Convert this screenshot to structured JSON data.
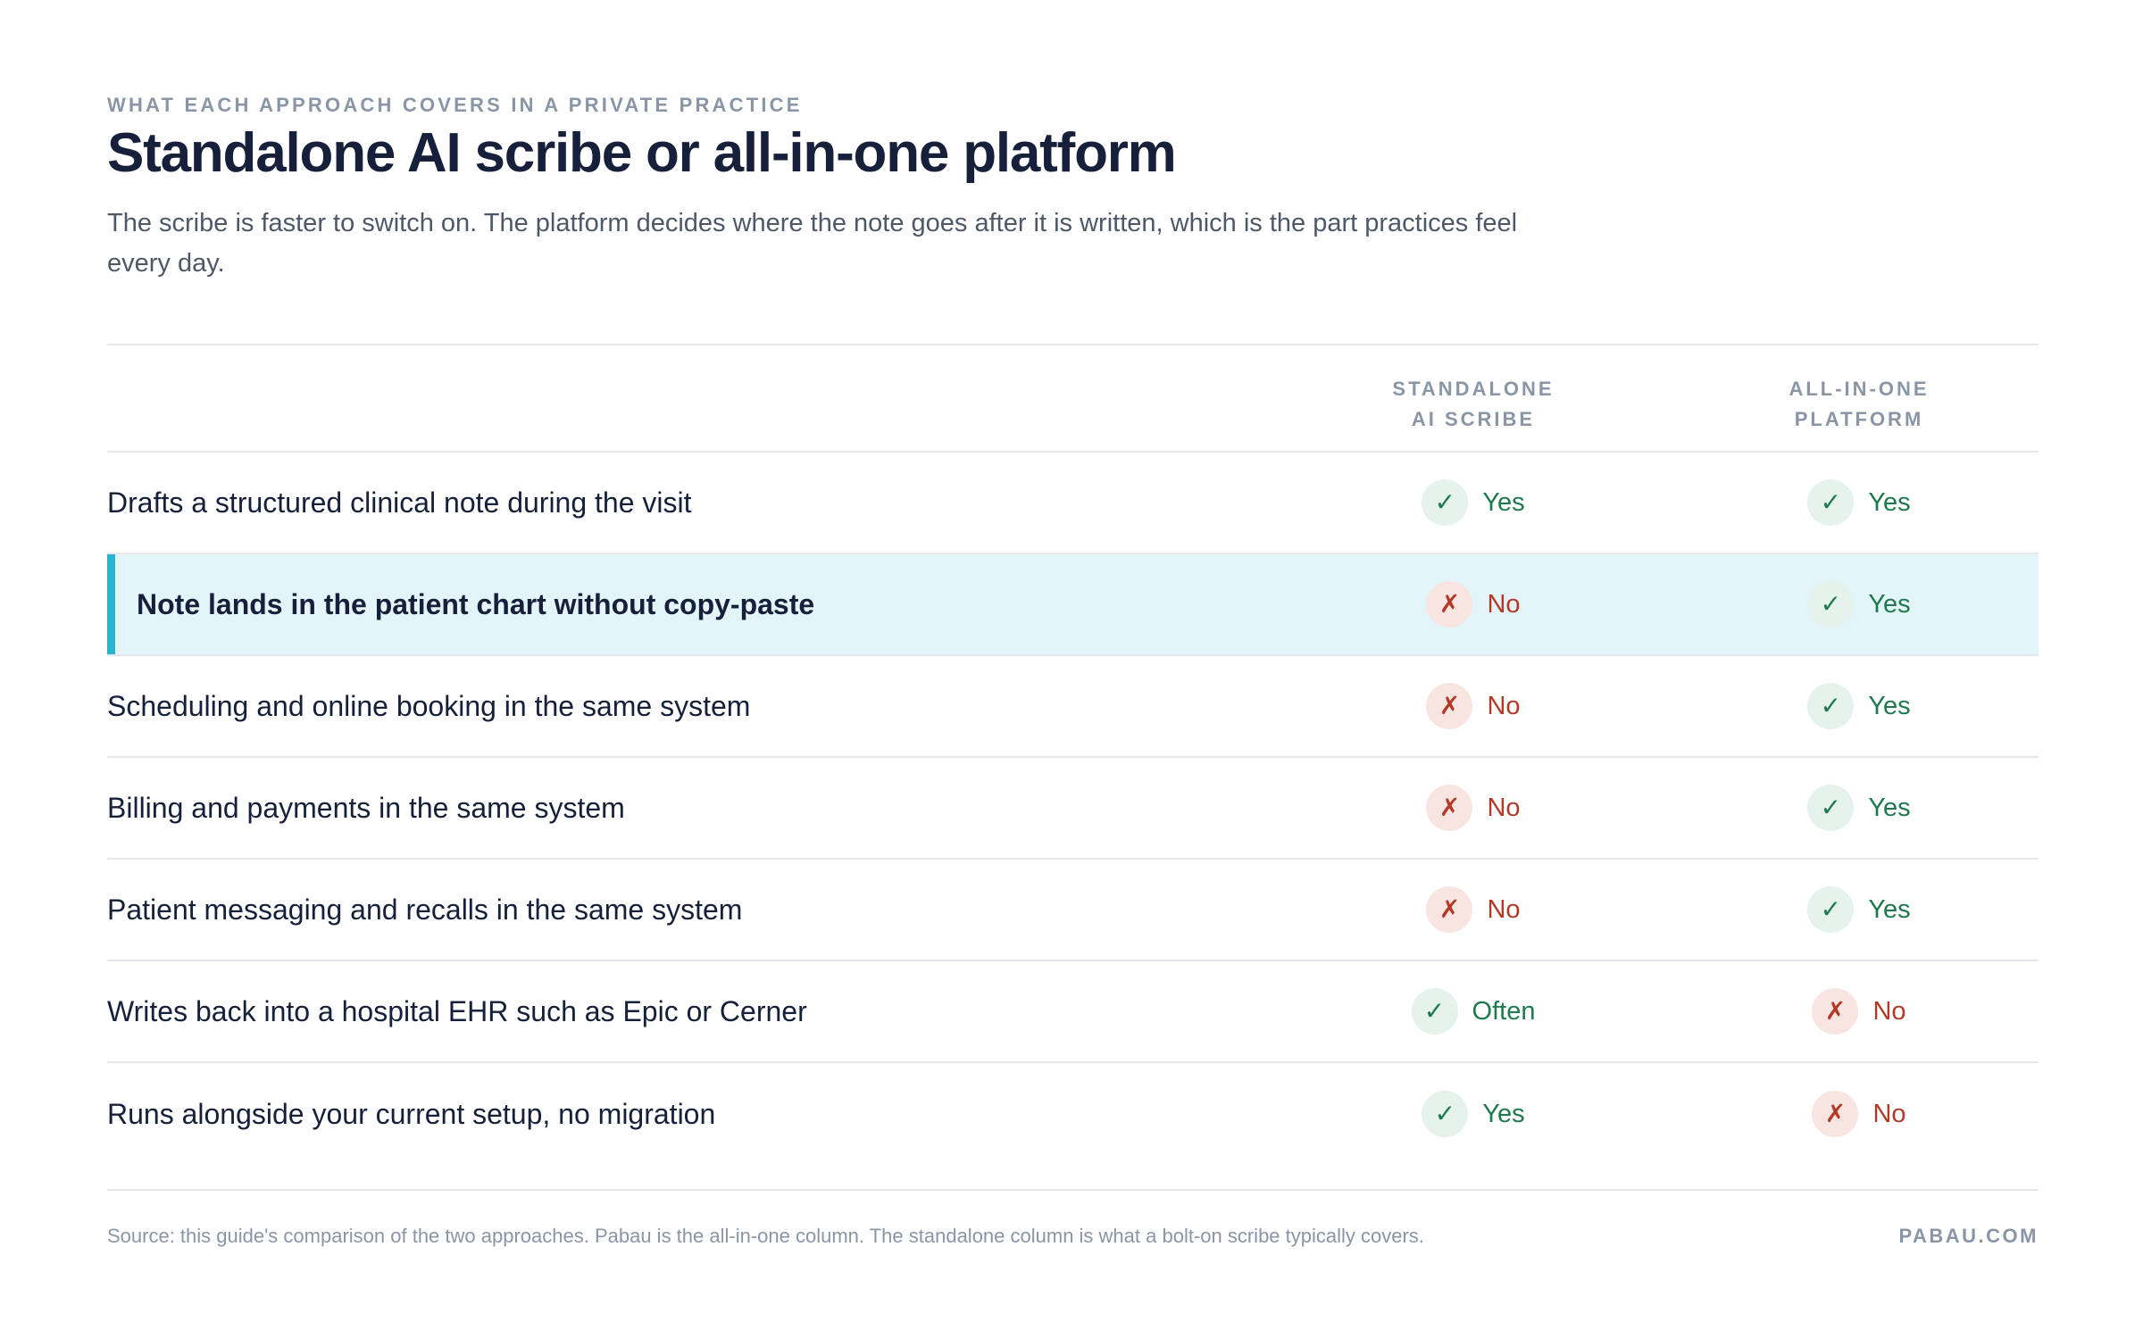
{
  "header": {
    "eyebrow": "WHAT EACH APPROACH COVERS IN A PRIVATE PRACTICE",
    "title": "Standalone AI scribe or all-in-one platform",
    "subtitle": "The scribe is faster to switch on. The platform decides where the note goes after it is written, which is the part practices feel every day."
  },
  "table": {
    "columns": [
      {
        "line1": "STANDALONE",
        "line2": "AI SCRIBE"
      },
      {
        "line1": "ALL-IN-ONE",
        "line2": "PLATFORM"
      }
    ],
    "rows": [
      {
        "label": "Drafts a structured clinical note during the visit",
        "highlight": false,
        "c1": {
          "text": "Yes",
          "status": "yes"
        },
        "c2": {
          "text": "Yes",
          "status": "yes"
        }
      },
      {
        "label": "Note lands in the patient chart without copy-paste",
        "highlight": true,
        "c1": {
          "text": "No",
          "status": "no"
        },
        "c2": {
          "text": "Yes",
          "status": "yes"
        }
      },
      {
        "label": "Scheduling and online booking in the same system",
        "highlight": false,
        "c1": {
          "text": "No",
          "status": "no"
        },
        "c2": {
          "text": "Yes",
          "status": "yes"
        }
      },
      {
        "label": "Billing and payments in the same system",
        "highlight": false,
        "c1": {
          "text": "No",
          "status": "no"
        },
        "c2": {
          "text": "Yes",
          "status": "yes"
        }
      },
      {
        "label": "Patient messaging and recalls in the same system",
        "highlight": false,
        "c1": {
          "text": "No",
          "status": "no"
        },
        "c2": {
          "text": "Yes",
          "status": "yes"
        }
      },
      {
        "label": "Writes back into a hospital EHR such as Epic or Cerner",
        "highlight": false,
        "c1": {
          "text": "Often",
          "status": "yes"
        },
        "c2": {
          "text": "No",
          "status": "no"
        }
      },
      {
        "label": "Runs alongside your current setup, no migration",
        "highlight": false,
        "c1": {
          "text": "Yes",
          "status": "yes"
        },
        "c2": {
          "text": "No",
          "status": "no"
        }
      }
    ],
    "icons": {
      "yes": "✓",
      "no": "✗"
    }
  },
  "footer": {
    "source": "Source: this guide's comparison of the two approaches. Pabau is the all-in-one column. The standalone column is what a bolt-on scribe typically covers.",
    "brand": "PABAU.COM"
  },
  "colors": {
    "accent": "#26b4cf",
    "highlight_bg": "#e3f5f8",
    "yes": "#1d7a4e",
    "no": "#b23a26"
  }
}
